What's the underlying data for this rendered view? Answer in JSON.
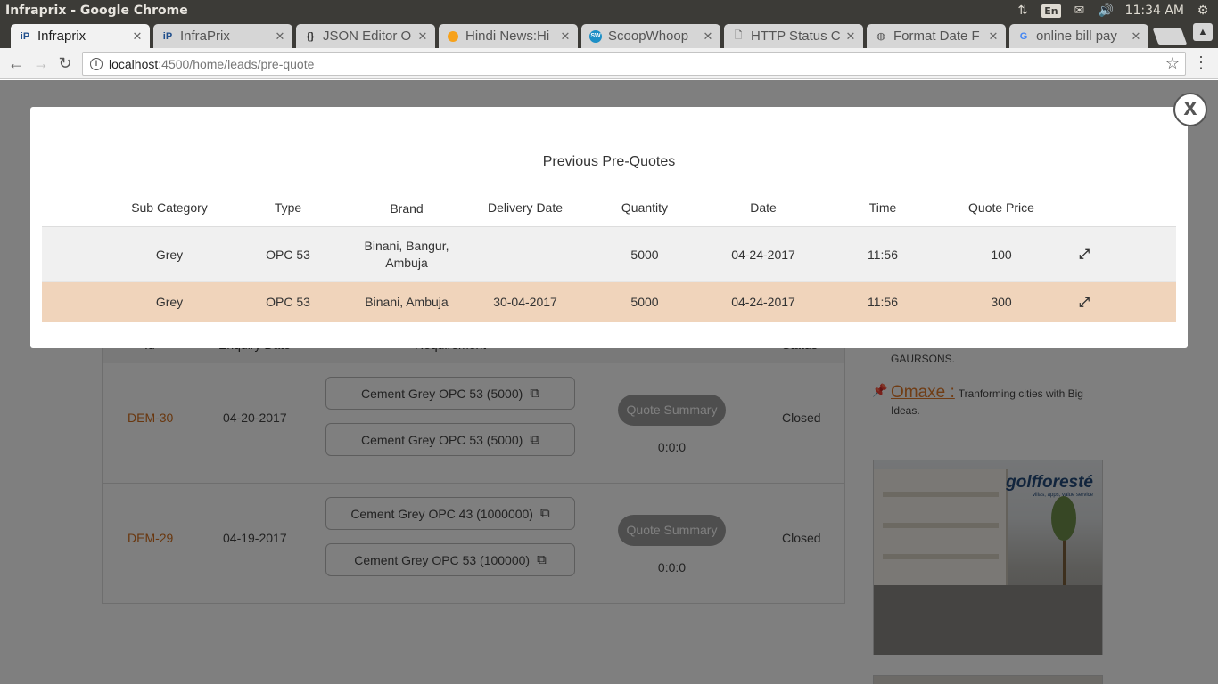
{
  "os": {
    "window_title": "Infraprix - Google Chrome",
    "lang": "En",
    "clock": "11:34 AM"
  },
  "browser": {
    "tabs": [
      {
        "label": "Infraprix",
        "active": true
      },
      {
        "label": "InfraPrix",
        "active": false
      },
      {
        "label": "JSON Editor O",
        "active": false
      },
      {
        "label": "Hindi News:Hi",
        "active": false
      },
      {
        "label": "ScoopWhoop",
        "active": false
      },
      {
        "label": "HTTP Status C",
        "active": false
      },
      {
        "label": "Format Date F",
        "active": false
      },
      {
        "label": "online bill pay",
        "active": false
      }
    ],
    "url_host": "localhost",
    "url_rest": ":4500/home/leads/pre-quote"
  },
  "page": {
    "leads_header": {
      "id": "Id",
      "enquiry_date": "Enquiry Date",
      "requirement": "Requirement",
      "status": "Status"
    },
    "leads": [
      {
        "id": "DEM-30",
        "date": "04-20-2017",
        "requirements": [
          "Cement Grey OPC 53 (5000)",
          "Cement Grey OPC 53 (5000)"
        ],
        "quote_summary": "Quote Summary",
        "count": "0:0:0",
        "status": "Closed"
      },
      {
        "id": "DEM-29",
        "date": "04-19-2017",
        "requirements": [
          "Cement Grey OPC 43 (1000000)",
          "Cement Grey OPC 53 (100000)"
        ],
        "quote_summary": "Quote Summary",
        "count": "0:0:0",
        "status": "Closed"
      }
    ],
    "sidebar": {
      "gaursons_text": "GAURSONS.",
      "omaxe_brand": "Omaxe :",
      "omaxe_text": "Tranforming cities with Big Ideas."
    },
    "ad": {
      "logo": "golfforesté",
      "tagline": "villas, apps, value service"
    }
  },
  "modal": {
    "title": "Previous Pre-Quotes",
    "close_label": "X",
    "columns": [
      "Sub Category",
      "Type",
      "Brand",
      "Delivery Date",
      "Quantity",
      "Date",
      "Time",
      "Quote Price"
    ],
    "rows": [
      {
        "sub_category": "Grey",
        "type": "OPC 53",
        "brand": "Binani, Bangur, Ambuja",
        "delivery_date": "",
        "quantity": "5000",
        "date": "04-24-2017",
        "time": "11:56",
        "quote_price": "100"
      },
      {
        "sub_category": "Grey",
        "type": "OPC 53",
        "brand": "Binani, Ambuja",
        "delivery_date": "30-04-2017",
        "quantity": "5000",
        "date": "04-24-2017",
        "time": "11:56",
        "quote_price": "300"
      }
    ]
  }
}
